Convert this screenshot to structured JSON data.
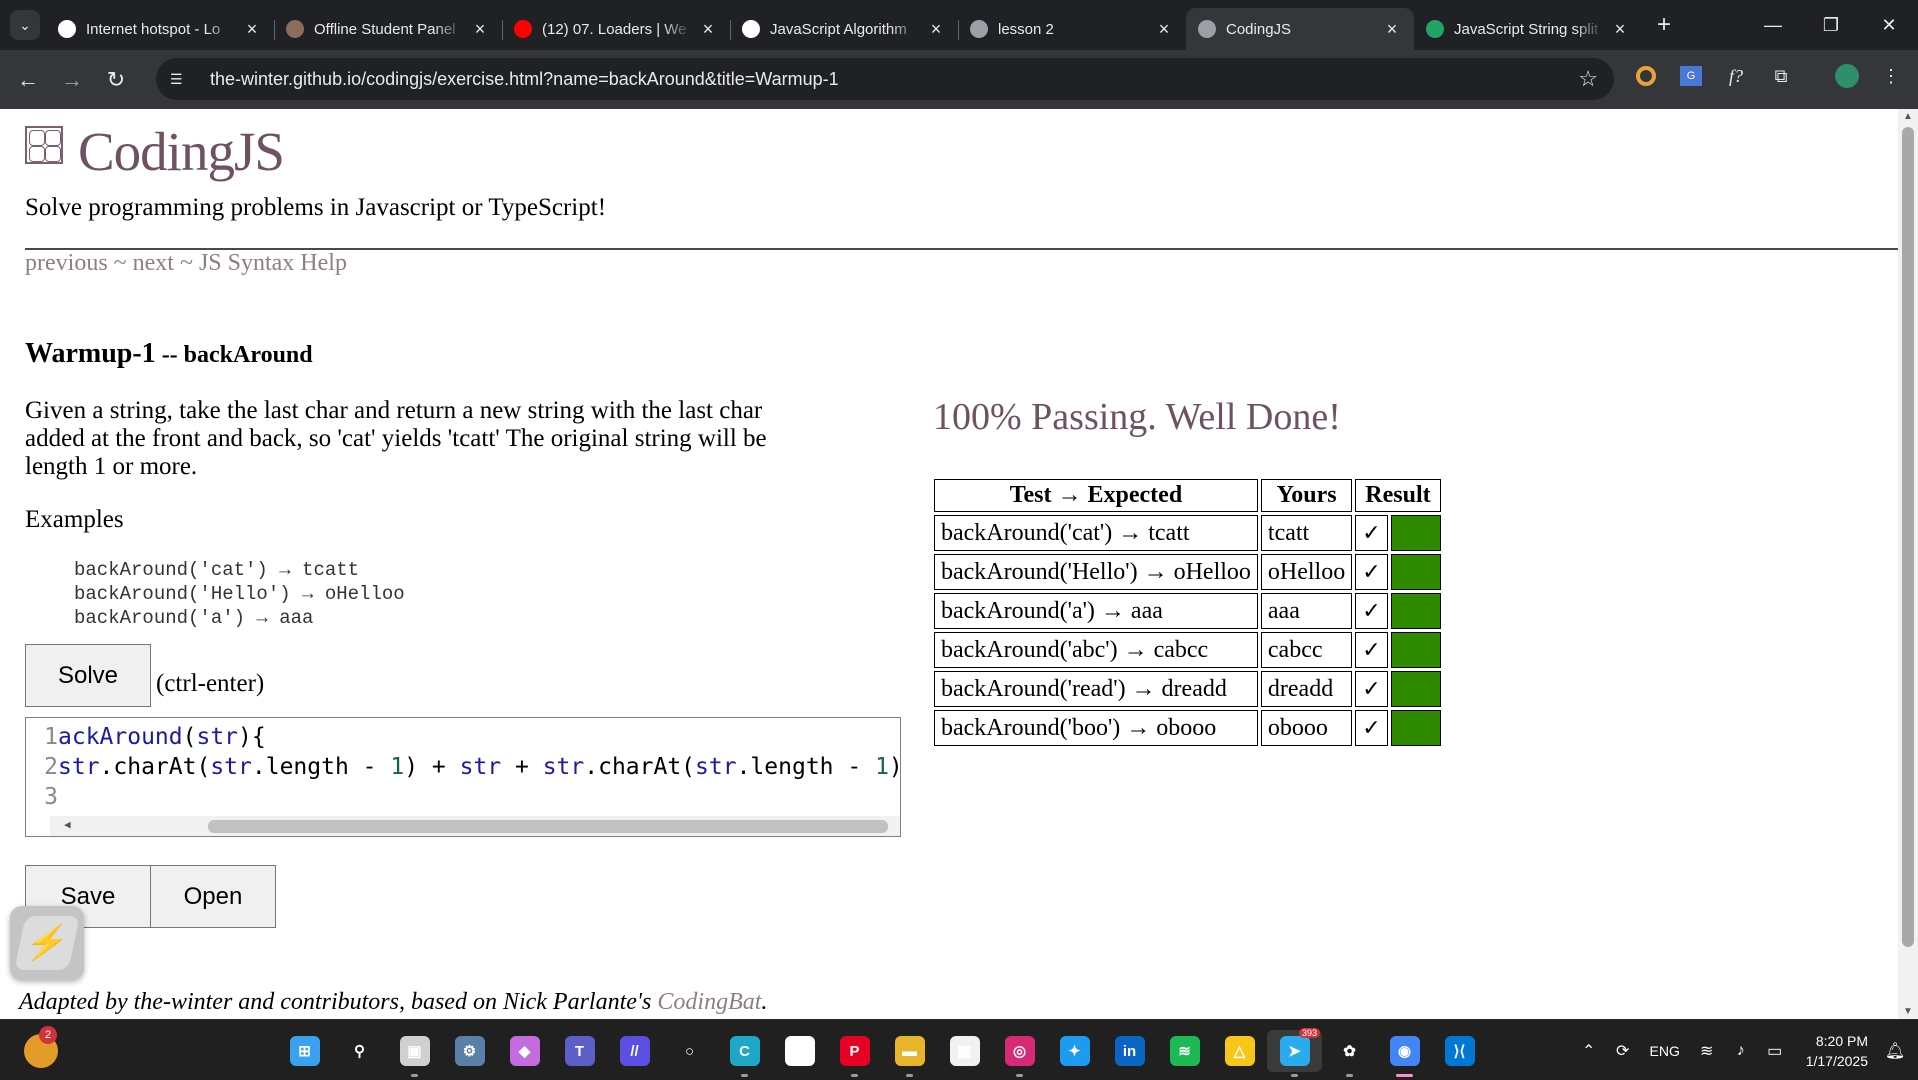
{
  "browser": {
    "tabs": [
      {
        "title": "Internet hotspot - Lo",
        "favicon_color": "#ffffff",
        "favicon": "wifi-icon"
      },
      {
        "title": "Offline Student Panel",
        "favicon_color": "#8a6d5a",
        "favicon": "panel-icon"
      },
      {
        "title": "(12) 07. Loaders | We",
        "favicon_color": "#ff0000",
        "favicon": "youtube-icon"
      },
      {
        "title": "JavaScript Algorithm",
        "favicon_color": "#ffffff",
        "favicon": "a-icon"
      },
      {
        "title": "lesson 2",
        "favicon_color": "#9aa0a6",
        "favicon": "globe-icon"
      },
      {
        "title": "CodingJS",
        "favicon_color": "#9aa0a6",
        "favicon": "globe-icon"
      },
      {
        "title": "JavaScript String split",
        "favicon_color": "#21a366",
        "favicon": "w3schools-icon"
      }
    ],
    "active_tab": 5,
    "url": "the-winter.github.io/codingjs/exercise.html?name=backAround&title=Warmup-1"
  },
  "page": {
    "brand": "CodingJS",
    "tagline": "Solve programming problems in Javascript or TypeScript!",
    "nav": {
      "previous": "previous",
      "next": "next",
      "help": "JS Syntax Help",
      "sep": "~"
    },
    "title_group": "Warmup-1",
    "title_dashes": " -- ",
    "title_name": "backAround",
    "description": "Given a string, take the last char and return a new string with the last char added at the front and back, so 'cat' yields 'tcatt' The original string will be length 1 or more.",
    "examples_heading": "Examples",
    "examples": [
      "backAround('cat') → tcatt",
      "backAround('Hello') → oHelloo",
      "backAround('a') → aaa"
    ],
    "solve_label": "Solve",
    "solve_hint": "(ctrl-enter)",
    "code_lines": [
      {
        "n": "1",
        "parts": [
          {
            "t": "ackAround",
            "c": "kw"
          },
          {
            "t": "(",
            "c": ""
          },
          {
            "t": "str",
            "c": "kw"
          },
          {
            "t": "){",
            "c": ""
          }
        ]
      },
      {
        "n": "2",
        "parts": [
          {
            "t": "str",
            "c": "kw"
          },
          {
            "t": ".charAt(",
            "c": ""
          },
          {
            "t": "str",
            "c": "kw"
          },
          {
            "t": ".length - ",
            "c": ""
          },
          {
            "t": "1",
            "c": "num"
          },
          {
            "t": ") + ",
            "c": ""
          },
          {
            "t": "str",
            "c": "kw"
          },
          {
            "t": " + ",
            "c": ""
          },
          {
            "t": "str",
            "c": "kw"
          },
          {
            "t": ".charAt(",
            "c": ""
          },
          {
            "t": "str",
            "c": "kw"
          },
          {
            "t": ".length - ",
            "c": ""
          },
          {
            "t": "1",
            "c": "num"
          },
          {
            "t": ")",
            "c": ""
          }
        ]
      },
      {
        "n": "3",
        "parts": []
      }
    ],
    "save_label": "Save",
    "open_label": "Open",
    "passing_text": "100% Passing. Well Done!",
    "results_headers": [
      "Test → Expected",
      "Yours",
      "Result"
    ],
    "results": [
      {
        "test": "backAround('cat') → tcatt",
        "yours": "tcatt",
        "mark": "✓"
      },
      {
        "test": "backAround('Hello') → oHelloo",
        "yours": "oHelloo",
        "mark": "✓"
      },
      {
        "test": "backAround('a') → aaa",
        "yours": "aaa",
        "mark": "✓"
      },
      {
        "test": "backAround('abc') → cabcc",
        "yours": "cabcc",
        "mark": "✓"
      },
      {
        "test": "backAround('read') → dreadd",
        "yours": "dreadd",
        "mark": "✓"
      },
      {
        "test": "backAround('boo') → obooo",
        "yours": "obooo",
        "mark": "✓"
      }
    ],
    "pass_color": "#2e8b00",
    "footer_text": "Adapted by the-winter and contributors, based on Nick Parlante's ",
    "footer_link": "CodingBat",
    "footer_end": "."
  },
  "taskbar": {
    "widget_badge": "2",
    "apps": [
      {
        "name": "windows-start-icon",
        "color": "#3aa0f0",
        "glyph": "⊞"
      },
      {
        "name": "search-icon",
        "color": "transparent",
        "glyph": "⚲"
      },
      {
        "name": "task-view-icon",
        "color": "#d0d0d0",
        "glyph": "▣"
      },
      {
        "name": "settings-icon",
        "color": "#5a7fa8",
        "glyph": "⚙"
      },
      {
        "name": "copilot-icon",
        "color": "#c56be0",
        "glyph": "◆"
      },
      {
        "name": "teams-icon",
        "color": "#5b5fc7",
        "glyph": "T"
      },
      {
        "name": "vs-icon",
        "color": "#5b4ee0",
        "glyph": "//"
      },
      {
        "name": "cortana-icon",
        "color": "transparent",
        "glyph": "○"
      },
      {
        "name": "canva-icon",
        "color": "#1fa7c7",
        "glyph": "C"
      },
      {
        "name": "capcut-icon",
        "color": "#ffffff",
        "glyph": "✂"
      },
      {
        "name": "pinterest-icon",
        "color": "#e60023",
        "glyph": "P"
      },
      {
        "name": "file-explorer-icon",
        "color": "#e8b42c",
        "glyph": "▬"
      },
      {
        "name": "store-icon",
        "color": "#f1f1f1",
        "glyph": "▦"
      },
      {
        "name": "instagram-icon",
        "color": "#d62976",
        "glyph": "◎"
      },
      {
        "name": "twitter-icon",
        "color": "#1d9bf0",
        "glyph": "✦"
      },
      {
        "name": "linkedin-icon",
        "color": "#0a66c2",
        "glyph": "in"
      },
      {
        "name": "spotify-icon",
        "color": "#1db954",
        "glyph": "≋"
      },
      {
        "name": "warning-app-icon",
        "color": "#f7c61a",
        "glyph": "△"
      },
      {
        "name": "telegram-icon",
        "color": "#2aabee",
        "glyph": "➤"
      },
      {
        "name": "chatgpt-icon",
        "color": "transparent",
        "glyph": "✿"
      },
      {
        "name": "chrome-icon",
        "color": "#4285f4",
        "glyph": "◉"
      },
      {
        "name": "vscode-icon",
        "color": "#0078d4",
        "glyph": "⟩⟨"
      }
    ],
    "telegram_badge": "393",
    "language": "ENG",
    "time": "8:20 PM",
    "date": "1/17/2025"
  }
}
